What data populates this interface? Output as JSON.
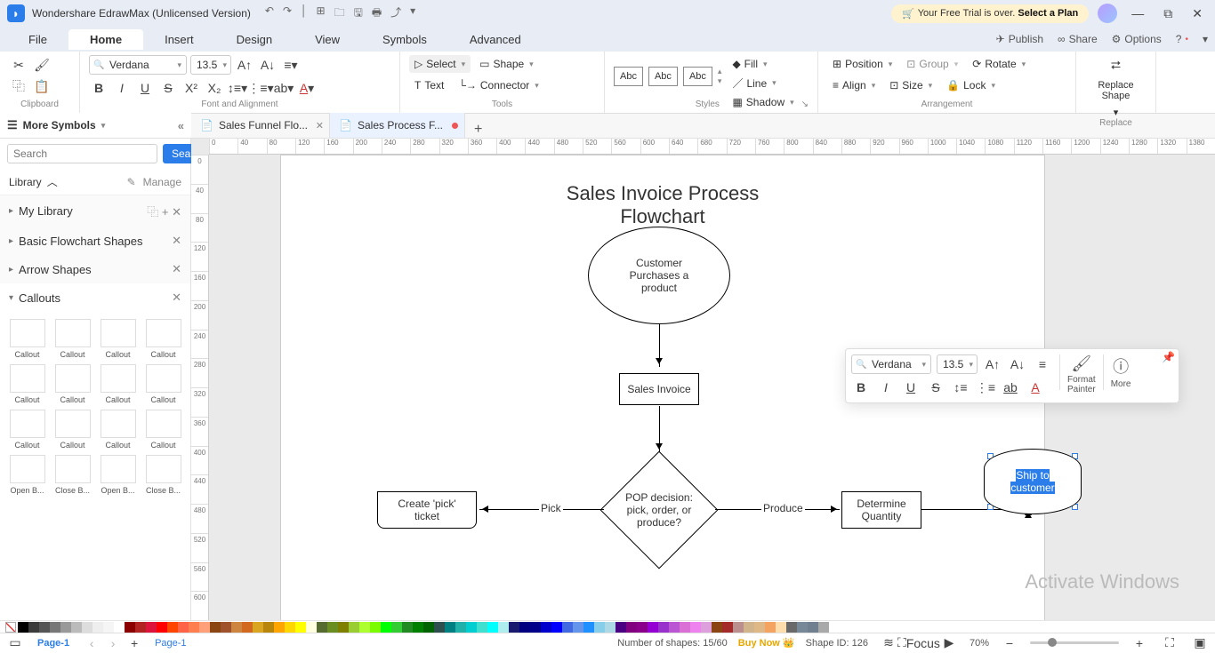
{
  "app": {
    "title": "Wondershare EdrawMax (Unlicensed Version)",
    "trial_prefix": "Your Free Trial is over. ",
    "trial_action": "Select a Plan"
  },
  "menu": {
    "file": "File",
    "home": "Home",
    "insert": "Insert",
    "design": "Design",
    "view": "View",
    "symbols": "Symbols",
    "advanced": "Advanced",
    "publish": "Publish",
    "share": "Share",
    "options": "Options"
  },
  "ribbon": {
    "clipboard": "Clipboard",
    "font_align": "Font and Alignment",
    "tools": "Tools",
    "styles": "Styles",
    "arrangement": "Arrangement",
    "replace": "Replace",
    "font": "Verdana",
    "size": "13.5",
    "select": "Select",
    "shape": "Shape",
    "text": "Text",
    "connector": "Connector",
    "fill": "Fill",
    "line": "Line",
    "shadow": "Shadow",
    "position": "Position",
    "group": "Group",
    "rotate": "Rotate",
    "align": "Align",
    "size_btn": "Size",
    "lock": "Lock",
    "replace_shape": "Replace\nShape",
    "style_abc": "Abc"
  },
  "tabs": {
    "t1": "Sales Funnel Flo...",
    "t2": "Sales Process F..."
  },
  "sidebar": {
    "more_symbols": "More Symbols",
    "search_ph": "Search",
    "search_btn": "Search",
    "library": "Library",
    "manage": "Manage",
    "my_library": "My Library",
    "basic_flowchart": "Basic Flowchart Shapes",
    "arrow_shapes": "Arrow Shapes",
    "callouts": "Callouts",
    "callout": "Callout",
    "openb": "Open B...",
    "closeb": "Close B..."
  },
  "chart_data": {
    "type": "flowchart",
    "title": "Sales Invoice Process\nFlowchart",
    "nodes": [
      {
        "id": "start",
        "shape": "terminator",
        "label": "Customer\nPurchases a\nproduct"
      },
      {
        "id": "invoice",
        "shape": "process",
        "label": "Sales Invoice"
      },
      {
        "id": "pop",
        "shape": "decision",
        "label": "POP decision:\npick, order, or\nproduce?"
      },
      {
        "id": "pick",
        "shape": "process_torn",
        "label": "Create 'pick'\nticket"
      },
      {
        "id": "qty",
        "shape": "process",
        "label": "Determine\nQuantity"
      },
      {
        "id": "ship",
        "shape": "terminator",
        "label": "Ship to\ncustomer",
        "selected": true
      }
    ],
    "edges": [
      {
        "from": "start",
        "to": "invoice"
      },
      {
        "from": "invoice",
        "to": "pop"
      },
      {
        "from": "pop",
        "to": "pick",
        "label": "Pick"
      },
      {
        "from": "pop",
        "to": "qty",
        "label": "Produce"
      },
      {
        "from": "qty",
        "to": "ship"
      }
    ]
  },
  "flow": {
    "title_l1": "Sales Invoice Process",
    "title_l2": "Flowchart",
    "n_start": "Customer\nPurchases a\nproduct",
    "n_invoice": "Sales Invoice",
    "n_pop": "POP decision:\npick, order, or\nproduce?",
    "n_pick": "Create 'pick'\nticket",
    "n_qty": "Determine\nQuantity",
    "n_ship_l1": "Ship to",
    "n_ship_l2": "customer",
    "e_pick": "Pick",
    "e_produce": "Produce"
  },
  "float": {
    "font": "Verdana",
    "size": "13.5",
    "format_painter": "Format\nPainter",
    "more": "More"
  },
  "status": {
    "page_label": "Page-1",
    "page_current": "Page-1",
    "shapes": "Number of shapes: 15/60",
    "buy": "Buy Now",
    "shape_id": "Shape ID: 126",
    "focus": "Focus",
    "zoom": "70%"
  },
  "ruler_h": [
    "0",
    "40",
    "80",
    "120",
    "160",
    "200",
    "240",
    "280",
    "320",
    "360",
    "400",
    "440",
    "480",
    "520",
    "560",
    "600",
    "640",
    "680",
    "720",
    "760",
    "800",
    "840",
    "880",
    "920",
    "960",
    "1000",
    "1040",
    "1080",
    "1120",
    "1160",
    "1200",
    "1240",
    "1280",
    "1320",
    "1380"
  ],
  "ruler_v": [
    "0",
    "40",
    "80",
    "120",
    "160",
    "200",
    "240",
    "280",
    "320",
    "360",
    "400",
    "440",
    "480",
    "520",
    "560",
    "600"
  ],
  "watermark": "Activate Windows"
}
